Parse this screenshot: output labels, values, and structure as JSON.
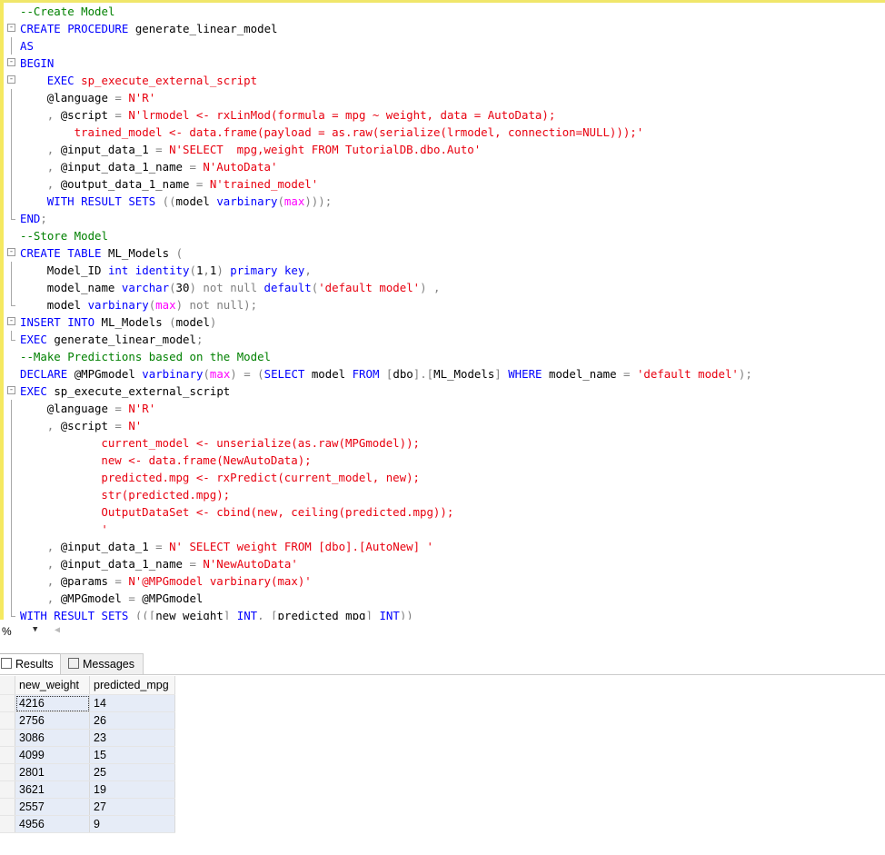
{
  "editor": {
    "lines": [
      {
        "fold": "",
        "guide": "none",
        "indent": 0,
        "segments": [
          [
            "c",
            "--Create Model"
          ]
        ]
      },
      {
        "fold": "-",
        "guide": "none",
        "indent": 0,
        "segments": [
          [
            "k",
            "CREATE PROCEDURE "
          ],
          [
            "n",
            "generate_linear_model"
          ]
        ]
      },
      {
        "fold": "",
        "guide": "mid",
        "indent": 0,
        "segments": [
          [
            "k",
            "AS"
          ]
        ]
      },
      {
        "fold": "-",
        "guide": "none",
        "indent": 0,
        "segments": [
          [
            "k",
            "BEGIN"
          ]
        ]
      },
      {
        "fold": "-",
        "guide": "mid",
        "indent": 4,
        "segments": [
          [
            "k",
            "EXEC "
          ],
          [
            "s",
            "sp_execute_external_script"
          ]
        ]
      },
      {
        "fold": "",
        "guide": "mid",
        "indent": 4,
        "segments": [
          [
            "n",
            "@language "
          ],
          [
            "g",
            "= "
          ],
          [
            "s",
            "N'R'"
          ]
        ]
      },
      {
        "fold": "",
        "guide": "mid",
        "indent": 4,
        "segments": [
          [
            "g",
            ", "
          ],
          [
            "n",
            "@script "
          ],
          [
            "g",
            "= "
          ],
          [
            "s",
            "N'lrmodel <- rxLinMod(formula = mpg ~ weight, data = AutoData);"
          ]
        ]
      },
      {
        "fold": "",
        "guide": "mid",
        "indent": 8,
        "segments": [
          [
            "s",
            "trained_model <- data.frame(payload = as.raw(serialize(lrmodel, connection=NULL)));'"
          ]
        ]
      },
      {
        "fold": "",
        "guide": "mid",
        "indent": 4,
        "segments": [
          [
            "g",
            ", "
          ],
          [
            "n",
            "@input_data_1 "
          ],
          [
            "g",
            "= "
          ],
          [
            "s",
            "N'SELECT  mpg,weight FROM TutorialDB.dbo.Auto'"
          ]
        ]
      },
      {
        "fold": "",
        "guide": "mid",
        "indent": 4,
        "segments": [
          [
            "g",
            ", "
          ],
          [
            "n",
            "@input_data_1_name "
          ],
          [
            "g",
            "= "
          ],
          [
            "s",
            "N'AutoData'"
          ]
        ]
      },
      {
        "fold": "",
        "guide": "mid",
        "indent": 4,
        "segments": [
          [
            "g",
            ", "
          ],
          [
            "n",
            "@output_data_1_name "
          ],
          [
            "g",
            "= "
          ],
          [
            "s",
            "N'trained_model'"
          ]
        ]
      },
      {
        "fold": "",
        "guide": "mid",
        "indent": 4,
        "segments": [
          [
            "k",
            "WITH RESULT SETS "
          ],
          [
            "g",
            "(("
          ],
          [
            "n",
            "model "
          ],
          [
            "k",
            "varbinary"
          ],
          [
            "g",
            "("
          ],
          [
            "f",
            "max"
          ],
          [
            "g",
            ")));"
          ]
        ]
      },
      {
        "fold": "",
        "guide": "end",
        "indent": 0,
        "segments": [
          [
            "k",
            "END"
          ],
          [
            "g",
            ";"
          ]
        ]
      },
      {
        "fold": "",
        "guide": "none",
        "indent": 0,
        "segments": [
          [
            "c",
            "--Store Model"
          ]
        ]
      },
      {
        "fold": "-",
        "guide": "none",
        "indent": 0,
        "segments": [
          [
            "k",
            "CREATE TABLE "
          ],
          [
            "n",
            "ML_Models "
          ],
          [
            "g",
            "("
          ]
        ]
      },
      {
        "fold": "",
        "guide": "mid",
        "indent": 4,
        "segments": [
          [
            "n",
            "Model_ID "
          ],
          [
            "k",
            "int identity"
          ],
          [
            "g",
            "("
          ],
          [
            "n",
            "1"
          ],
          [
            "g",
            ","
          ],
          [
            "n",
            "1"
          ],
          [
            "g",
            ") "
          ],
          [
            "k",
            "primary key"
          ],
          [
            "g",
            ","
          ]
        ]
      },
      {
        "fold": "",
        "guide": "mid",
        "indent": 4,
        "segments": [
          [
            "n",
            "model_name "
          ],
          [
            "k",
            "varchar"
          ],
          [
            "g",
            "("
          ],
          [
            "n",
            "30"
          ],
          [
            "g",
            ") "
          ],
          [
            "g",
            "not null "
          ],
          [
            "k",
            "default"
          ],
          [
            "g",
            "("
          ],
          [
            "s",
            "'default model'"
          ],
          [
            "g",
            ") ,"
          ]
        ]
      },
      {
        "fold": "",
        "guide": "end",
        "indent": 4,
        "segments": [
          [
            "n",
            "model "
          ],
          [
            "k",
            "varbinary"
          ],
          [
            "g",
            "("
          ],
          [
            "f",
            "max"
          ],
          [
            "g",
            ") "
          ],
          [
            "g",
            "not null"
          ],
          [
            "g",
            ");"
          ]
        ]
      },
      {
        "fold": "-",
        "guide": "none",
        "indent": 0,
        "segments": [
          [
            "k",
            "INSERT INTO "
          ],
          [
            "n",
            "ML_Models "
          ],
          [
            "g",
            "("
          ],
          [
            "n",
            "model"
          ],
          [
            "g",
            ")"
          ]
        ]
      },
      {
        "fold": "",
        "guide": "end",
        "indent": 0,
        "segments": [
          [
            "k",
            "EXEC "
          ],
          [
            "n",
            "generate_linear_model"
          ],
          [
            "g",
            ";"
          ]
        ]
      },
      {
        "fold": "",
        "guide": "none",
        "indent": 0,
        "segments": [
          [
            "c",
            "--Make Predictions based on the Model"
          ]
        ]
      },
      {
        "fold": "",
        "guide": "none",
        "indent": 0,
        "segments": [
          [
            "k",
            "DECLARE "
          ],
          [
            "n",
            "@MPGmodel "
          ],
          [
            "k",
            "varbinary"
          ],
          [
            "g",
            "("
          ],
          [
            "f",
            "max"
          ],
          [
            "g",
            ") = ("
          ],
          [
            "k",
            "SELECT "
          ],
          [
            "n",
            "model "
          ],
          [
            "k",
            "FROM "
          ],
          [
            "g",
            "["
          ],
          [
            "n",
            "dbo"
          ],
          [
            "g",
            "].["
          ],
          [
            "n",
            "ML_Models"
          ],
          [
            "g",
            "] "
          ],
          [
            "k",
            "WHERE "
          ],
          [
            "n",
            "model_name "
          ],
          [
            "g",
            "= "
          ],
          [
            "s",
            "'default model'"
          ],
          [
            "g",
            ");"
          ]
        ]
      },
      {
        "fold": "-",
        "guide": "none",
        "indent": 0,
        "segments": [
          [
            "k",
            "EXEC "
          ],
          [
            "n",
            "sp_execute_external_script"
          ]
        ]
      },
      {
        "fold": "",
        "guide": "mid",
        "indent": 4,
        "segments": [
          [
            "n",
            "@language "
          ],
          [
            "g",
            "= "
          ],
          [
            "s",
            "N'R'"
          ]
        ]
      },
      {
        "fold": "",
        "guide": "mid",
        "indent": 4,
        "segments": [
          [
            "g",
            ", "
          ],
          [
            "n",
            "@script "
          ],
          [
            "g",
            "= "
          ],
          [
            "s",
            "N'"
          ]
        ]
      },
      {
        "fold": "",
        "guide": "mid",
        "indent": 12,
        "segments": [
          [
            "s",
            "current_model <- unserialize(as.raw(MPGmodel));"
          ]
        ]
      },
      {
        "fold": "",
        "guide": "mid",
        "indent": 12,
        "segments": [
          [
            "s",
            "new <- data.frame(NewAutoData);"
          ]
        ]
      },
      {
        "fold": "",
        "guide": "mid",
        "indent": 12,
        "segments": [
          [
            "s",
            "predicted.mpg <- rxPredict(current_model, new);"
          ]
        ]
      },
      {
        "fold": "",
        "guide": "mid",
        "indent": 12,
        "segments": [
          [
            "s",
            "str(predicted.mpg);"
          ]
        ]
      },
      {
        "fold": "",
        "guide": "mid",
        "indent": 12,
        "segments": [
          [
            "s",
            "OutputDataSet <- cbind(new, ceiling(predicted.mpg));"
          ]
        ]
      },
      {
        "fold": "",
        "guide": "mid",
        "indent": 12,
        "segments": [
          [
            "s",
            "'"
          ]
        ]
      },
      {
        "fold": "",
        "guide": "mid",
        "indent": 4,
        "segments": [
          [
            "g",
            ", "
          ],
          [
            "n",
            "@input_data_1 "
          ],
          [
            "g",
            "= "
          ],
          [
            "s",
            "N' SELECT weight FROM [dbo].[AutoNew] '"
          ]
        ]
      },
      {
        "fold": "",
        "guide": "mid",
        "indent": 4,
        "segments": [
          [
            "g",
            ", "
          ],
          [
            "n",
            "@input_data_1_name "
          ],
          [
            "g",
            "= "
          ],
          [
            "s",
            "N'NewAutoData'"
          ]
        ]
      },
      {
        "fold": "",
        "guide": "mid",
        "indent": 4,
        "segments": [
          [
            "g",
            ", "
          ],
          [
            "n",
            "@params "
          ],
          [
            "g",
            "= "
          ],
          [
            "s",
            "N'@MPGmodel varbinary(max)'"
          ]
        ]
      },
      {
        "fold": "",
        "guide": "mid",
        "indent": 4,
        "segments": [
          [
            "g",
            ", "
          ],
          [
            "n",
            "@MPGmodel "
          ],
          [
            "g",
            "= "
          ],
          [
            "n",
            "@MPGmodel"
          ]
        ]
      },
      {
        "fold": "",
        "guide": "end",
        "indent": 0,
        "segments": [
          [
            "k",
            "WITH RESULT SETS "
          ],
          [
            "g",
            "(("
          ],
          [
            "g",
            "["
          ],
          [
            "n",
            "new_weight"
          ],
          [
            "g",
            "] "
          ],
          [
            "k",
            "INT"
          ],
          [
            "g",
            ", ["
          ],
          [
            "n",
            "predicted_mpg"
          ],
          [
            "g",
            "] "
          ],
          [
            "k",
            "INT"
          ],
          [
            "g",
            "))"
          ]
        ]
      }
    ]
  },
  "statusbar": {
    "zoom": "%",
    "dropdown_glyph": "▼",
    "scroll_glyph": "◀"
  },
  "results": {
    "tabs": [
      {
        "label": "Results",
        "active": true
      },
      {
        "label": "Messages",
        "active": false
      }
    ],
    "columns": [
      "new_weight",
      "predicted_mpg"
    ],
    "rows": [
      [
        "4216",
        "14"
      ],
      [
        "2756",
        "26"
      ],
      [
        "3086",
        "23"
      ],
      [
        "4099",
        "15"
      ],
      [
        "2801",
        "25"
      ],
      [
        "3621",
        "19"
      ],
      [
        "2557",
        "27"
      ],
      [
        "4956",
        "9"
      ]
    ]
  }
}
